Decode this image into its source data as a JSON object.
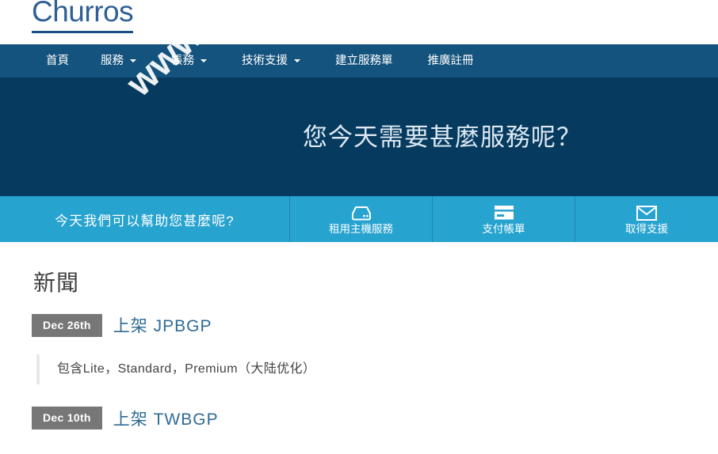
{
  "site": {
    "logo_text": "Churros",
    "watermark": "www.Veldc.com",
    "accent_navy": "#14537d",
    "accent_hero": "#063a5e",
    "accent_cyan": "#27a3cf",
    "link_blue": "#2f6b96",
    "badge_gray": "#777777"
  },
  "nav": {
    "items": [
      {
        "label": "首頁",
        "has_caret": false
      },
      {
        "label": "服務",
        "has_caret": true
      },
      {
        "label": "帳務",
        "has_caret": true
      },
      {
        "label": "技術支援",
        "has_caret": true
      },
      {
        "label": "建立服務單",
        "has_caret": false
      },
      {
        "label": "推廣註冊",
        "has_caret": false
      }
    ]
  },
  "hero": {
    "title": "您今天需要甚麼服務呢？"
  },
  "actionbar": {
    "tagline": "今天我們可以幫助您甚麼呢?",
    "buttons": [
      {
        "label": "租用主機服務",
        "icon": "server-icon"
      },
      {
        "label": "支付帳單",
        "icon": "credit-card-icon"
      },
      {
        "label": "取得支援",
        "icon": "envelope-icon"
      }
    ]
  },
  "news": {
    "heading": "新聞",
    "items": [
      {
        "date": "Dec 26th",
        "title": "上架 JPBGP",
        "body": "包含Lite，Standard，Premium（大陆优化）"
      },
      {
        "date": "Dec 10th",
        "title": "上架 TWBGP",
        "body": ""
      }
    ]
  }
}
